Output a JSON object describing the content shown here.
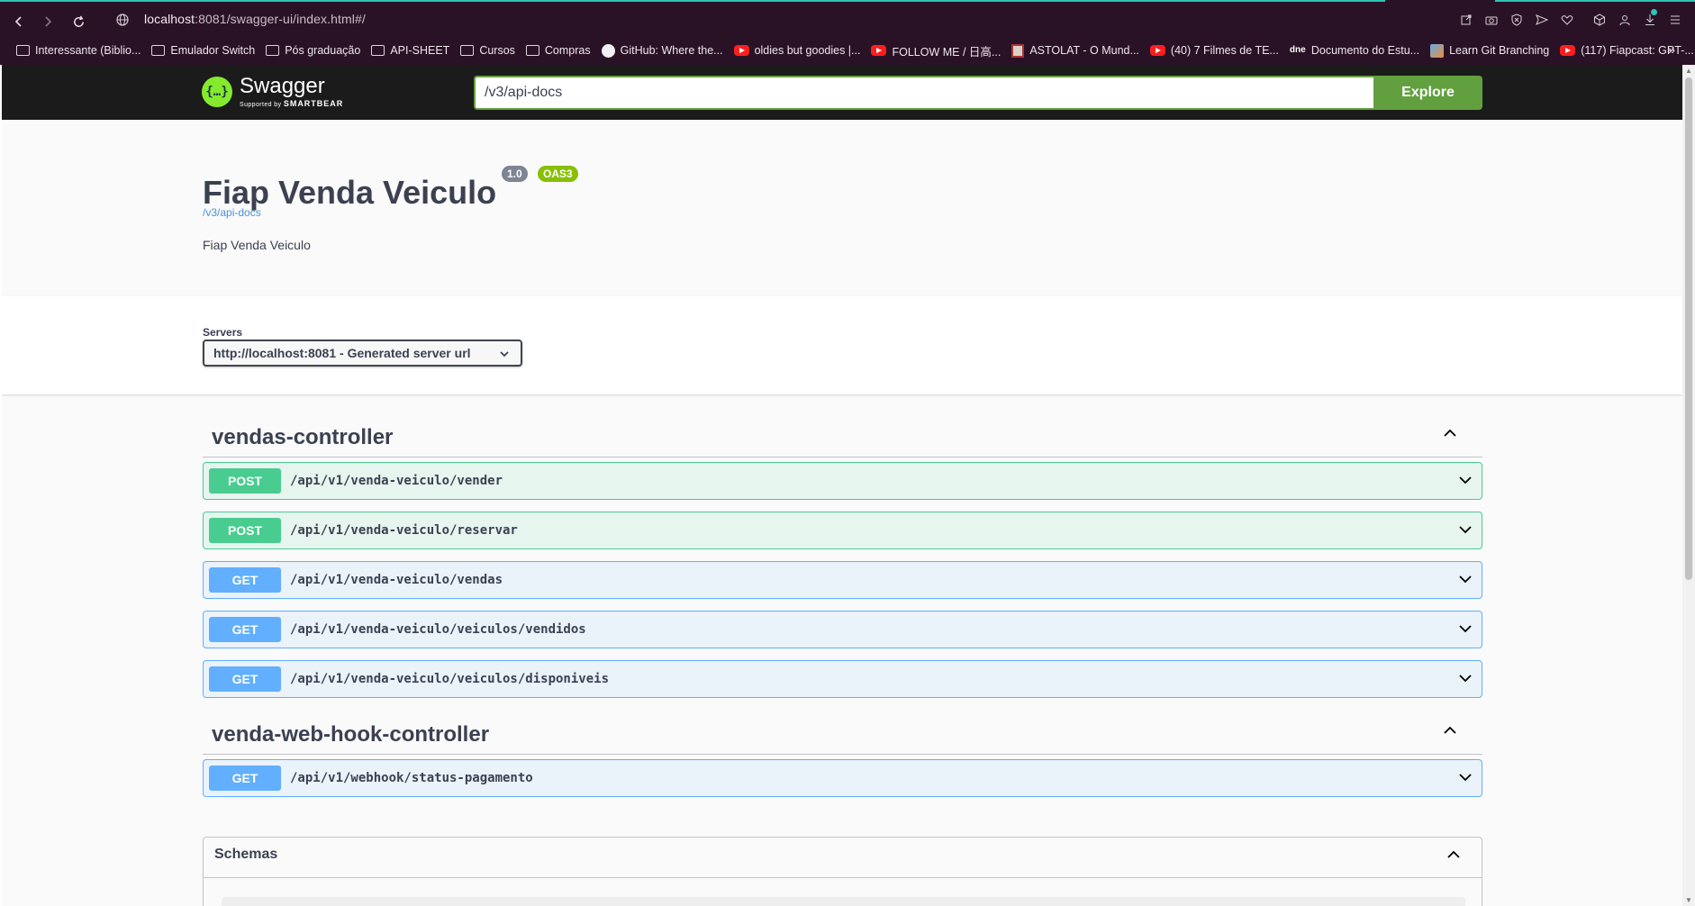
{
  "browser": {
    "url_host": "localhost",
    "url_rest": ":8081/swagger-ui/index.html#/",
    "bookmarks": [
      {
        "label": "Interessante (Biblio...",
        "icon": "folder-icon"
      },
      {
        "label": "Emulador Switch",
        "icon": "folder-icon"
      },
      {
        "label": "Pós graduação",
        "icon": "folder-icon"
      },
      {
        "label": "API-SHEET",
        "icon": "folder-icon"
      },
      {
        "label": "Cursos",
        "icon": "folder-icon"
      },
      {
        "label": "Compras",
        "icon": "folder-icon"
      },
      {
        "label": "GitHub: Where the...",
        "icon": "github-icon"
      },
      {
        "label": "oldies but goodies |...",
        "icon": "youtube-icon"
      },
      {
        "label": "FOLLOW ME / 日高...",
        "icon": "youtube-icon"
      },
      {
        "label": "ASTOLAT - O Mund...",
        "icon": "image-icon"
      },
      {
        "label": "(40) 7 Filmes de TE...",
        "icon": "youtube-icon"
      },
      {
        "label": "Documento do Estu...",
        "icon": "dne-icon"
      },
      {
        "label": "Learn Git Branching",
        "icon": "git-icon"
      },
      {
        "label": "(117) Fiapcast: GPT-...",
        "icon": "youtube-icon"
      }
    ],
    "more": "»"
  },
  "swagger": {
    "logo_text": "Swagger",
    "logo_glyph": "{…}",
    "logo_sub_prefix": "Supported by",
    "logo_sub_brand": "SMARTBEAR",
    "search_value": "/v3/api-docs",
    "explore_label": "Explore"
  },
  "info": {
    "title": "Fiap Venda Veiculo",
    "version": "1.0",
    "oas": "OAS3",
    "spec_link": "/v3/api-docs",
    "description": "Fiap Venda Veiculo"
  },
  "servers": {
    "label": "Servers",
    "selected": "http://localhost:8081 - Generated server url"
  },
  "tags": [
    {
      "name": "vendas-controller",
      "operations": [
        {
          "method": "POST",
          "path": "/api/v1/venda-veiculo/vender"
        },
        {
          "method": "POST",
          "path": "/api/v1/venda-veiculo/reservar"
        },
        {
          "method": "GET",
          "path": "/api/v1/venda-veiculo/vendas"
        },
        {
          "method": "GET",
          "path": "/api/v1/venda-veiculo/veiculos/vendidos"
        },
        {
          "method": "GET",
          "path": "/api/v1/venda-veiculo/veiculos/disponiveis"
        }
      ]
    },
    {
      "name": "venda-web-hook-controller",
      "operations": [
        {
          "method": "GET",
          "path": "/api/v1/webhook/status-pagamento"
        }
      ]
    }
  ],
  "schemas": {
    "title": "Schemas"
  },
  "colors": {
    "post": "#49cc90",
    "get": "#61affe",
    "explore": "#62a03f",
    "topbar": "#1b1b1b",
    "chrome": "#2a1226"
  }
}
